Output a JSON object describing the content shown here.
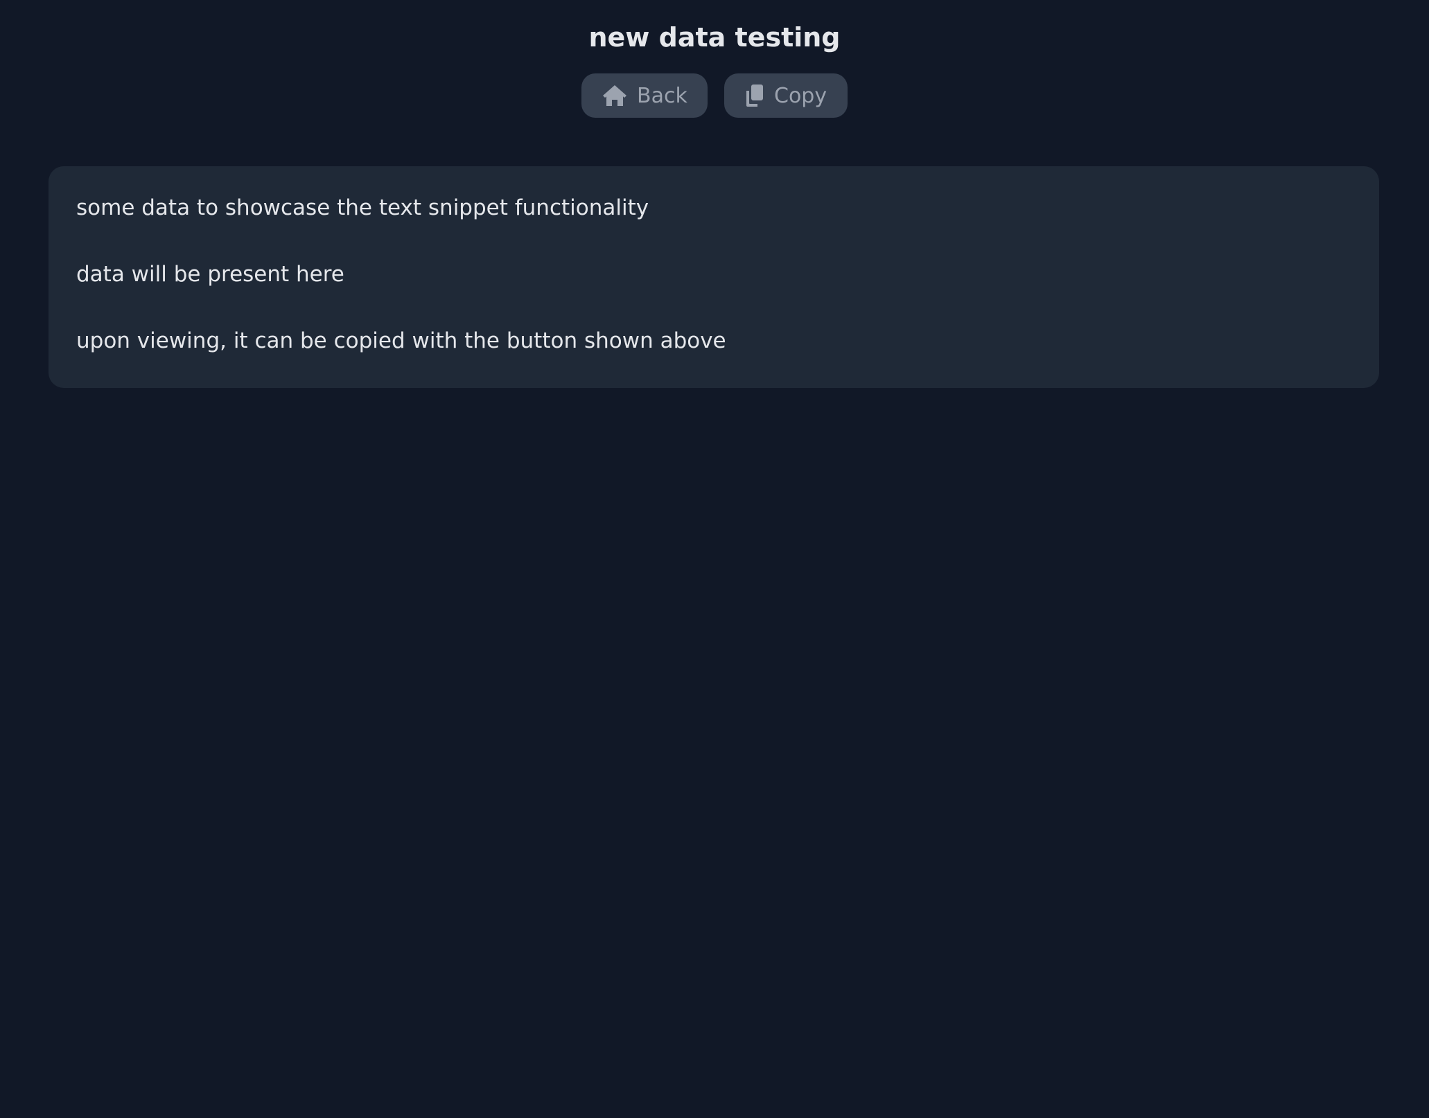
{
  "header": {
    "title": "new data testing"
  },
  "toolbar": {
    "back_label": "Back",
    "back_icon": "home-icon",
    "copy_label": "Copy",
    "copy_icon": "copy-icon"
  },
  "snippet": {
    "lines": [
      "some data to showcase the text snippet functionality",
      "data will be present here",
      "upon viewing, it can be copied with the button shown above"
    ]
  },
  "colors": {
    "background": "#111827",
    "card": "#1f2937",
    "button": "#374151",
    "button_text": "#9ca3af",
    "text": "#e5e7eb"
  }
}
